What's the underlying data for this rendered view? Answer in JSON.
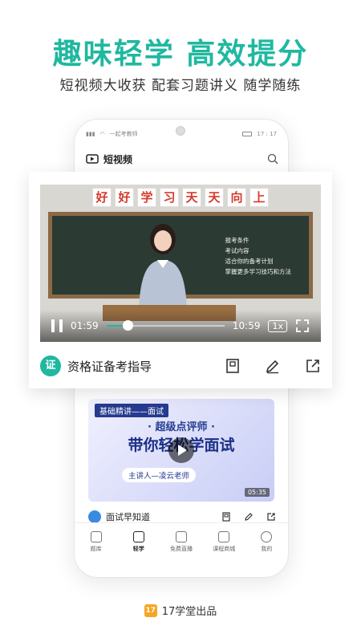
{
  "headline": "趣味轻学 高效提分",
  "subline": "短视频大收获 配套习题讲义 随学随练",
  "status": {
    "carrier": "一起考教师",
    "time": "17 : 17"
  },
  "appbar": {
    "title": "短视频"
  },
  "video": {
    "banner": [
      "好",
      "好",
      "学",
      "习",
      "天",
      "天",
      "向",
      "上"
    ],
    "board_notes": [
      "报考条件",
      "考试内容",
      "适合你的备考计划",
      "掌握更多学习技巧和方法"
    ],
    "current_time": "01:59",
    "total_time": "10:59",
    "progress": 0.18,
    "speed": "1x"
  },
  "card": {
    "badge": "证",
    "title": "资格证备考指导"
  },
  "card2": {
    "tag": "基础精讲——面试",
    "line1": "· 超级点评师 ·",
    "line2": "带你轻松学面试",
    "presenter": "主讲人—凌云老师",
    "duration": "05:35"
  },
  "row2": {
    "title": "面试早知道"
  },
  "tabs": [
    {
      "label": "题库"
    },
    {
      "label": "轻学"
    },
    {
      "label": "免费直播"
    },
    {
      "label": "课程商城"
    },
    {
      "label": "我的"
    }
  ],
  "footer": {
    "logo": "17",
    "text": "17学堂出品"
  },
  "colors": {
    "accent": "#1fb8a0"
  }
}
